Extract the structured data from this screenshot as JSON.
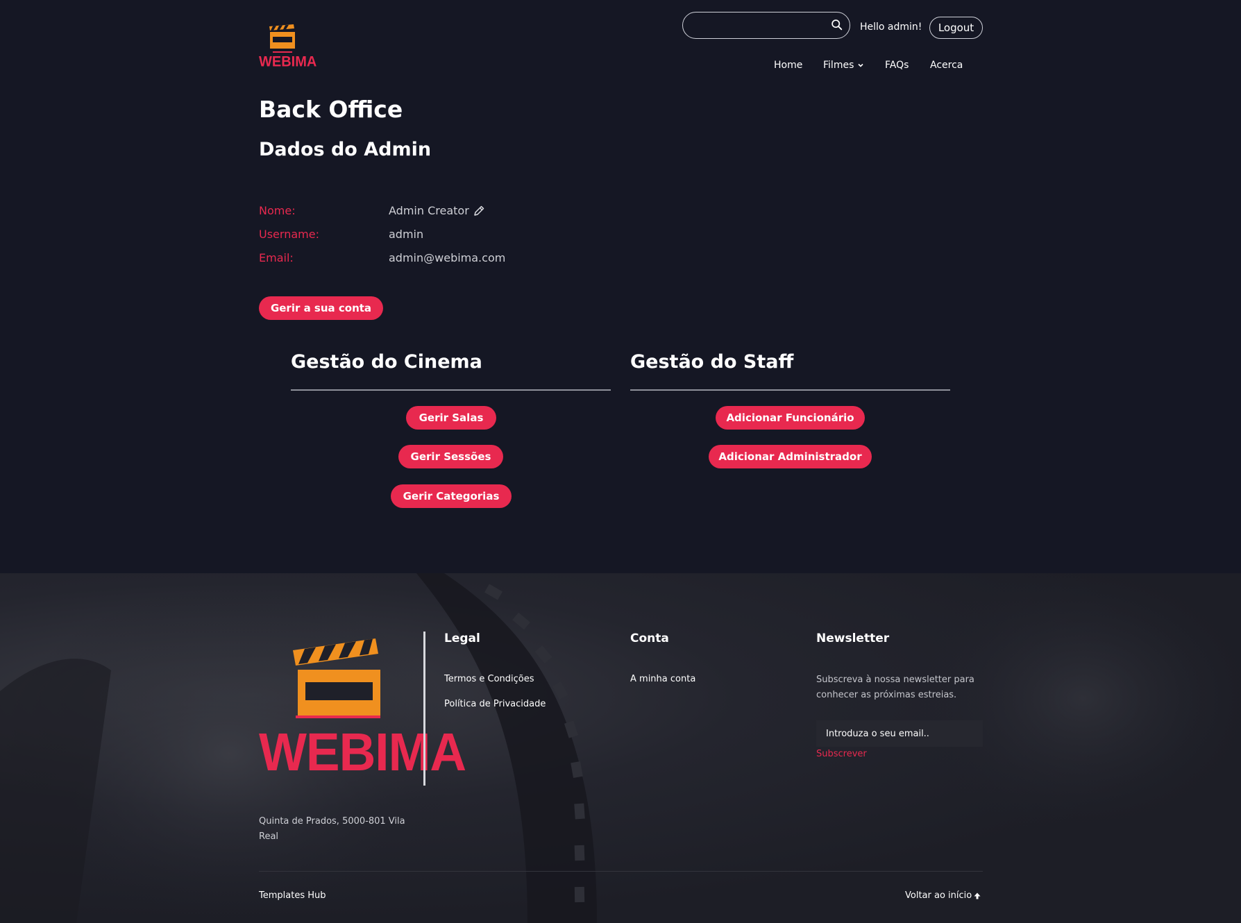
{
  "header": {
    "logo_text": "WEBIMA",
    "search": {
      "value": "",
      "placeholder": ""
    },
    "greeting": "Hello admin!",
    "logout_label": "Logout",
    "nav": [
      {
        "label": "Home"
      },
      {
        "label": "Filmes",
        "has_dropdown": true
      },
      {
        "label": "FAQs"
      },
      {
        "label": "Acerca"
      }
    ]
  },
  "main": {
    "title": "Back Office",
    "subtitle": "Dados do Admin",
    "fields": [
      {
        "label": "Nome:",
        "value": "Admin Creator",
        "editable": true
      },
      {
        "label": "Username:",
        "value": "admin"
      },
      {
        "label": "Email:",
        "value": "admin@webima.com"
      }
    ],
    "manage_account_label": "Gerir a sua conta",
    "cinema": {
      "title": "Gestão do Cinema",
      "buttons": [
        "Gerir Salas",
        "Gerir Sessões",
        "Gerir Categorias"
      ]
    },
    "staff": {
      "title": "Gestão do Staff",
      "buttons": [
        "Adicionar Funcionário",
        "Adicionar Administrador"
      ]
    }
  },
  "footer": {
    "logo_text": "WEBIMA",
    "address": "Quinta de Prados, 5000-801 Vila Real",
    "legal": {
      "title": "Legal",
      "links": [
        "Termos e Condições",
        "Política de Privacidade"
      ]
    },
    "account": {
      "title": "Conta",
      "links": [
        "A minha conta"
      ]
    },
    "newsletter": {
      "title": "Newsletter",
      "text": "Subscreva à nossa newsletter para conhecer as próximas estreias.",
      "placeholder": "Introduza o seu email..",
      "subscribe_label": "Subscrever"
    },
    "credit": "Templates Hub",
    "back_to_top": "Voltar ao início"
  },
  "colors": {
    "background": "#151724",
    "accent": "#e8294f",
    "logo_orange": "#f0901f"
  },
  "icons": {
    "search": "search-icon",
    "edit": "pencil-icon",
    "dropdown": "chevron-down-icon",
    "back_to_top": "arrow-up-icon",
    "logo": "clapperboard-icon"
  }
}
